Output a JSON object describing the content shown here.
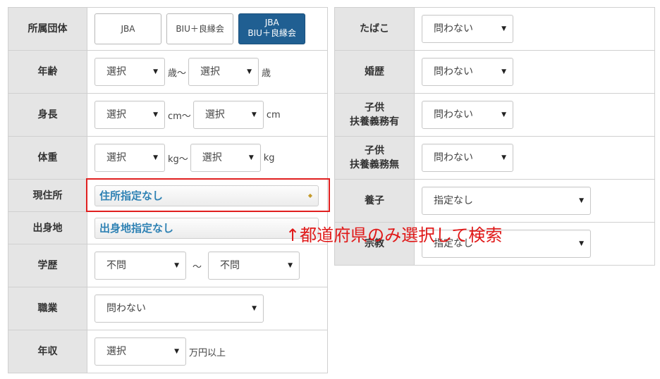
{
  "left": {
    "affiliation": {
      "label": "所属団体",
      "buttons": [
        {
          "line1": "JBA",
          "line2": ""
        },
        {
          "line1": "BIU＋良縁会",
          "line2": ""
        },
        {
          "line1": "JBA",
          "line2": "BIU＋良縁会"
        }
      ]
    },
    "age": {
      "label": "年齢",
      "from": "選択",
      "sep": "歳〜",
      "to": "選択",
      "unit": "歳"
    },
    "height": {
      "label": "身長",
      "from": "選択",
      "sep": "cm〜",
      "to": "選択",
      "unit": "cm"
    },
    "weight": {
      "label": "体重",
      "from": "選択",
      "sep": "kg〜",
      "to": "選択",
      "unit": "kg"
    },
    "residence": {
      "label": "現住所",
      "value": "住所指定なし"
    },
    "birthplace": {
      "label": "出身地",
      "value": "出身地指定なし"
    },
    "education": {
      "label": "学歴",
      "from": "不問",
      "sep": "〜",
      "to": "不問"
    },
    "occupation": {
      "label": "職業",
      "value": "問わない"
    },
    "income": {
      "label": "年収",
      "value": "選択",
      "unit": "万円以上"
    }
  },
  "right": {
    "tobacco": {
      "label": "たばこ",
      "value": "問わない"
    },
    "marriage": {
      "label": "婚歴",
      "value": "問わない"
    },
    "children_support": {
      "label_line1": "子供",
      "label_line2": "扶養義務有",
      "value": "問わない"
    },
    "children_nosupport": {
      "label_line1": "子供",
      "label_line2": "扶養義務無",
      "value": "問わない"
    },
    "adoption": {
      "label": "養子",
      "value": "指定なし"
    },
    "religion": {
      "label": "宗教",
      "value": "指定なし"
    }
  },
  "annotation": "↑都道府県のみ選択して検索",
  "colors": {
    "header_bg": "#e5e5e5",
    "active_button": "#205f92",
    "highlight": "#e02020",
    "link_text": "#2f82b4"
  }
}
